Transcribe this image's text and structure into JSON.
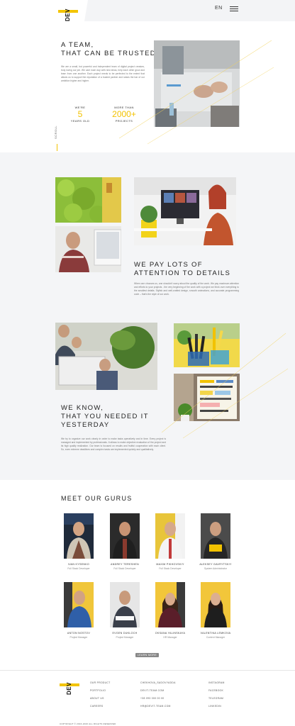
{
  "header": {
    "logo_text": "DEV",
    "lang": "EN"
  },
  "hero": {
    "title_line1": "A TEAM,",
    "title_line2": "THAT CAN BE TRUSTED",
    "text": "We are a small, but powerful and independent team of digital project creators, truly loving our job. We care each day with new ideas, help each other grow and learn from one another. Each project needs to be perfected to the extent that allows us to support the reputation of a trusted partner and raises the bar of our ambition higher and higher.",
    "stat1_top": "WE'RE",
    "stat1_num": "5",
    "stat1_bottom": "YEARS OLD",
    "stat2_top": "MORE THAN",
    "stat2_num": "2000+",
    "stat2_bottom": "PROJECTS",
    "scroll": "SCROLL"
  },
  "details": {
    "title_line1": "WE PAY LOTS OF",
    "title_line2": "ATTENTION TO DETAILS",
    "text": "When one chooses us, one shouldn't worry about the quality of the work. We pay maximum attention and efforts to your projects - the very beginning of the work with a project we think over everything to the smallest details. Stylish and well-crafted design, smooth animations, and accurate programming code – that's the style of our work."
  },
  "know": {
    "title_line1": "WE KNOW,",
    "title_line2": "THAT YOU NEEDED IT",
    "title_line3": "YESTERDAY",
    "text": "We try to organize our work clearly in order to make tasks operatively and in time. Every project is managed and implemented by professionals. It allows to make objective evaluation of the project and its high quality realization. Our team is focused on results and fruitful cooperation with each client. So, even extreme deadlines and complex tasks are implemented quickly and qualitatively."
  },
  "gurus": {
    "title": "MEET OUR GURUS",
    "members": [
      {
        "name": "IVAN KYSENKO",
        "role": "Full Stack Developer"
      },
      {
        "name": "ANDREY TERESHEN",
        "role": "Full Stack Developer"
      },
      {
        "name": "MAXIM PIKHOVSKIY",
        "role": "Full Stack Developer"
      },
      {
        "name": "ALEKSEY GAVRYTSKIY",
        "role": "System Administrator"
      },
      {
        "name": "ANTON NOSTOV",
        "role": "Project Manager"
      },
      {
        "name": "EVGEN DUKLOCH",
        "role": "Project Manager"
      },
      {
        "name": "OKSANA YALINSKAYA",
        "role": "HR Manager"
      },
      {
        "name": "VALENTINA LEMKOVA",
        "role": "Content Manager"
      }
    ],
    "learn_more": "LEARN MORE"
  },
  "footer": {
    "col1": [
      "OUR PRODUCT",
      "PORTFOLIO",
      "ABOUT US",
      "CAREERS"
    ],
    "col2": [
      "CHEKHOVA_SADOVYADDA",
      "DEVIT-TEAM.COM",
      "+38 093 000 00 00",
      "HR@DEVIT-TEAM.COM"
    ],
    "col3": [
      "INSTAGRAM",
      "FACEBOOK",
      "TELEGRAM",
      "LINKEDIN"
    ],
    "copyright": "COPYRIGHT © 2016-2020 ALL RIGHTS RESERVED"
  },
  "colors": {
    "accent": "#f2c200",
    "gray_section": "#f4f5f7",
    "button": "#888888"
  }
}
